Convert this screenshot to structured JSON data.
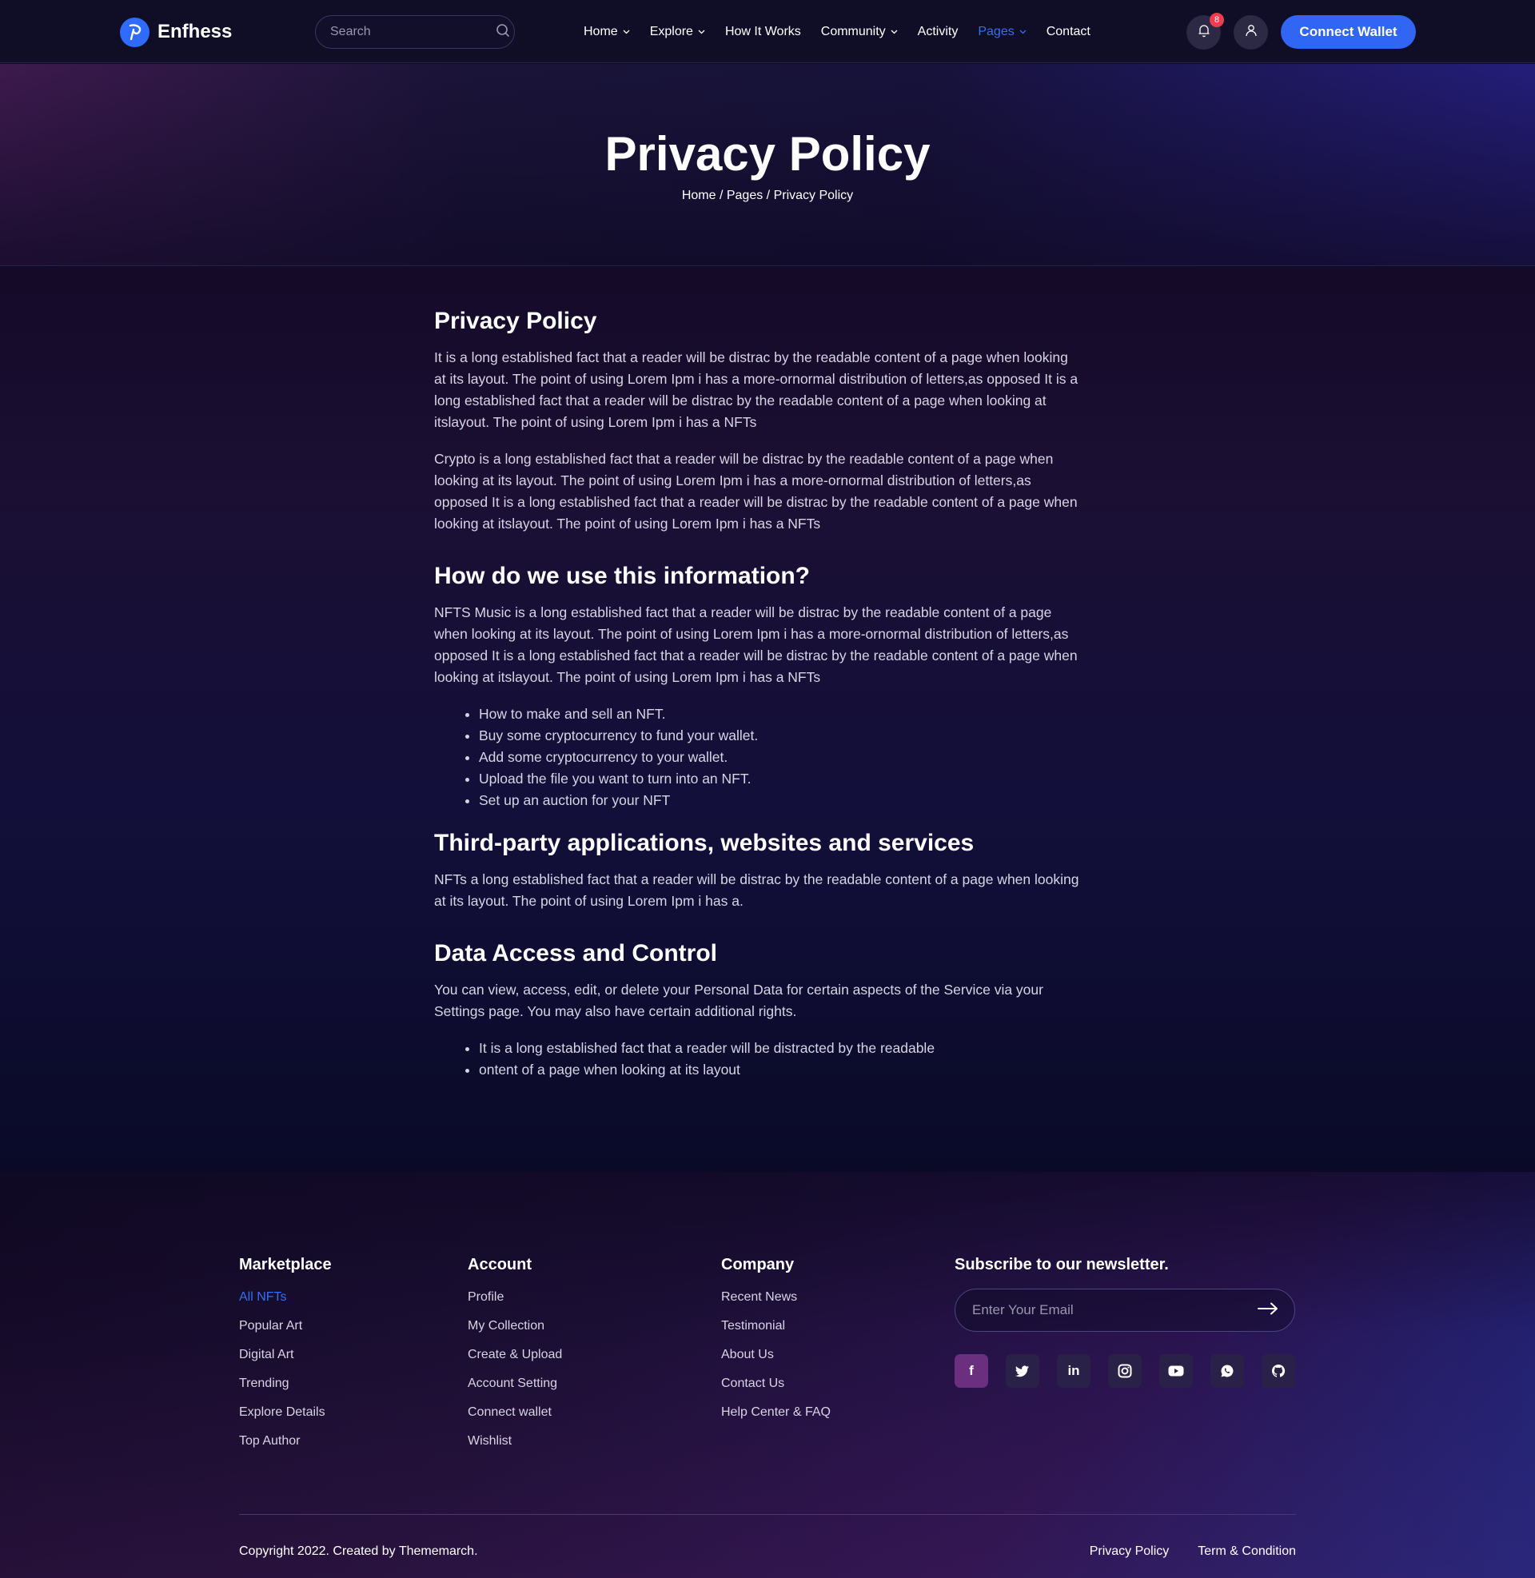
{
  "header": {
    "brand": "Enfhess",
    "search_placeholder": "Search",
    "nav": [
      {
        "label": "Home",
        "dropdown": true
      },
      {
        "label": "Explore",
        "dropdown": true
      },
      {
        "label": "How It Works",
        "dropdown": false
      },
      {
        "label": "Community",
        "dropdown": true
      },
      {
        "label": "Activity",
        "dropdown": false
      },
      {
        "label": "Pages",
        "dropdown": true,
        "active": true
      },
      {
        "label": "Contact",
        "dropdown": false
      }
    ],
    "notification_count": "8",
    "connect_label": "Connect Wallet",
    "accent_color": "#3166f5"
  },
  "hero": {
    "title": "Privacy Policy",
    "breadcrumb": "Home / Pages / Privacy Policy"
  },
  "content": {
    "s1_heading": "Privacy Policy",
    "s1_p1": "It is a long established fact that a reader will be distrac by the readable content of a page when looking at its layout. The point of using Lorem Ipm i has a more-ornormal distribution of letters,as opposed It is a long established fact that a reader will be distrac by the readable content of a page when looking at itslayout. The point of using Lorem Ipm i has a NFTs",
    "s1_p2": "Crypto is a long established fact that a reader will be distrac by the readable content of a page when looking at its layout. The point of using Lorem Ipm i has a more-ornormal distribution of letters,as opposed It is a long established fact that a reader will be distrac by the readable content of a page when looking at itslayout. The point of using Lorem Ipm i has a NFTs",
    "s2_heading": "How do we use this information?",
    "s2_p1": "NFTS Music is a long established fact that a reader will be distrac by the readable content of a page when looking at its layout. The point of using Lorem Ipm i has a more-ornormal distribution of letters,as opposed It is a long established fact that a reader will be distrac by the readable content of a page when looking at itslayout. The point of using Lorem Ipm i has a NFTs",
    "s2_list": [
      "How to make and sell an NFT.",
      "Buy some cryptocurrency to fund your wallet.",
      "Add some cryptocurrency to your wallet.",
      "Upload the file you want to turn into an NFT.",
      "Set up an auction for your NFT"
    ],
    "s3_heading": "Third-party applications, websites and services",
    "s3_p1": "NFTs a long established fact that a reader will be distrac by the readable content of a page when looking at its layout. The point of using Lorem Ipm i has a.",
    "s4_heading": "Data Access and Control",
    "s4_p1": "You can view, access, edit, or delete your Personal Data for certain aspects of the Service via your Settings page. You may also have certain additional rights.",
    "s4_list": [
      "It is a long established fact that a reader will be distracted by the readable",
      "ontent of a page when looking at its layout"
    ]
  },
  "footer": {
    "marketplace": {
      "title": "Marketplace",
      "links": [
        "All NFTs",
        "Popular Art",
        "Digital Art",
        "Trending",
        "Explore Details",
        "Top Author"
      ]
    },
    "account": {
      "title": "Account",
      "links": [
        "Profile",
        "My Collection",
        "Create & Upload",
        "Account Setting",
        "Connect wallet",
        "Wishlist"
      ]
    },
    "company": {
      "title": "Company",
      "links": [
        "Recent News",
        "Testimonial",
        "About Us",
        "Contact Us",
        "Help Center & FAQ"
      ]
    },
    "newsletter": {
      "title": "Subscribe to our newsletter.",
      "placeholder": "Enter Your Email"
    },
    "socials": [
      "facebook-icon",
      "twitter-icon",
      "linkedin-icon",
      "instagram-icon",
      "youtube-icon",
      "whatsapp-icon",
      "github-icon"
    ],
    "copyright": "Copyright 2022. Created by Thememarch.",
    "bottom_links": [
      "Privacy Policy",
      "Term & Condition"
    ]
  }
}
